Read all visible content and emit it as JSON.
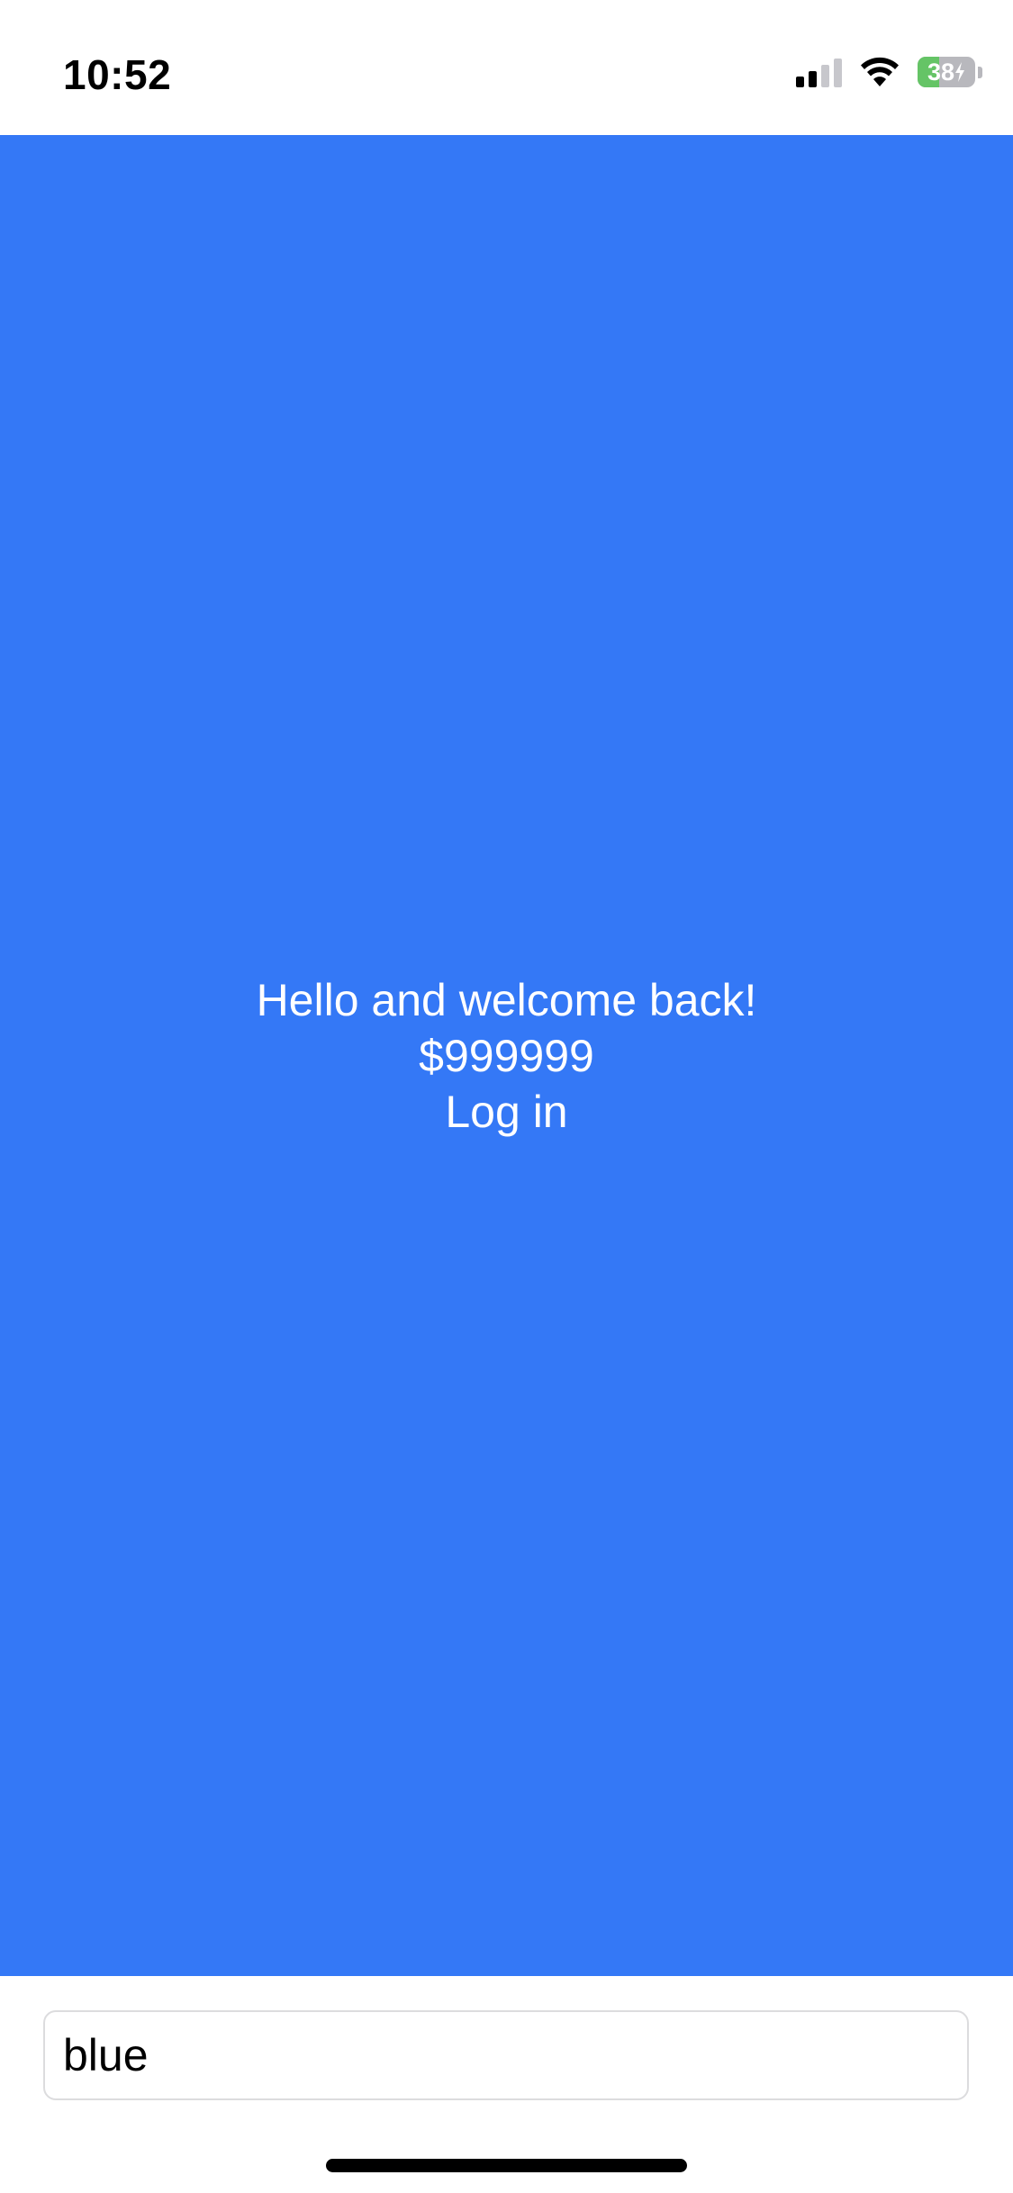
{
  "status_bar": {
    "time": "10:52",
    "signal_bars_active": 2,
    "signal_bars_total": 4,
    "battery_level": 38,
    "battery_text": "38",
    "battery_charging": true,
    "icons": [
      "cellular-signal-icon",
      "wifi-icon",
      "battery-icon",
      "charging-bolt-icon"
    ]
  },
  "main": {
    "background_color": "#3478f6",
    "greeting": "Hello and welcome back!",
    "balance": "$999999",
    "login_label": "Log in"
  },
  "input": {
    "value": "blue"
  },
  "colors": {
    "accent_blue": "#3478f6",
    "battery_green": "#65c466"
  }
}
